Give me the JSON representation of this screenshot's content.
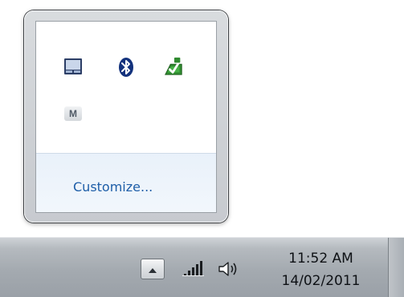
{
  "overflow_flyout": {
    "icons": [
      {
        "name": "touchpad-icon"
      },
      {
        "name": "bluetooth-icon"
      },
      {
        "name": "safely-remove-hardware-icon"
      },
      {
        "name": "m-app-icon",
        "label": "M"
      }
    ],
    "customize_label": "Customize..."
  },
  "taskbar": {
    "show_hidden_icons": "chevron-up-icon",
    "network_icon": "signal-bars-icon",
    "volume_icon": "speaker-icon",
    "clock": {
      "time": "11:52 AM",
      "date": "14/02/2011"
    }
  },
  "colors": {
    "link": "#1e5ea8",
    "customize_bg": "#e9f1fa",
    "taskbar": "#a4aab0",
    "bluetooth": "#1f4aa8",
    "eject_green": "#2e8b2e"
  }
}
